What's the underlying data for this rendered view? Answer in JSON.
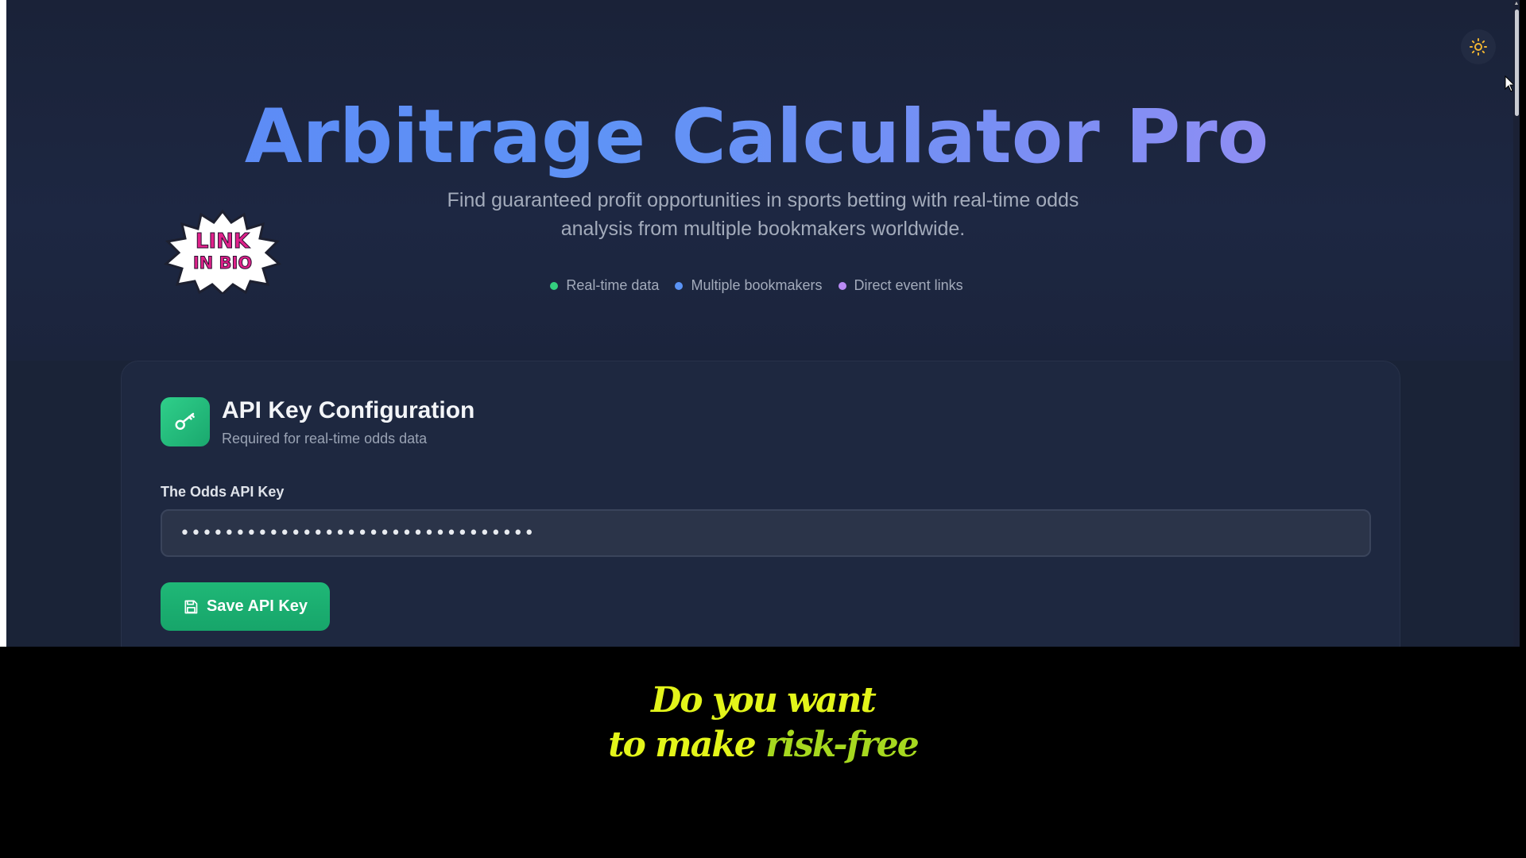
{
  "header": {
    "title": "Arbitrage Calculator Pro",
    "subtitle": "Find guaranteed profit opportunities in sports betting with real-time odds analysis from multiple bookmakers worldwide.",
    "features": [
      {
        "label": "Real-time data",
        "color": "#34d07f"
      },
      {
        "label": "Multiple bookmakers",
        "color": "#5a93f5"
      },
      {
        "label": "Direct event links",
        "color": "#b98af5"
      }
    ]
  },
  "theme_toggle": {
    "icon": "sun-icon",
    "color": "#f2b632"
  },
  "sticker": {
    "line1": "LINK",
    "line2": "IN BIO",
    "color": "#e0218a"
  },
  "api_card": {
    "icon": "key-icon",
    "title": "API Key Configuration",
    "subtitle": "Required for real-time odds data",
    "field_label": "The Odds API Key",
    "field_value": "••••••••••••••••••••••••••••••••",
    "save_label": "Save API Key",
    "save_icon": "save-icon"
  },
  "caption": {
    "line1": "Do you want",
    "line2_a": "to make",
    "line2_b": "risk-free"
  }
}
